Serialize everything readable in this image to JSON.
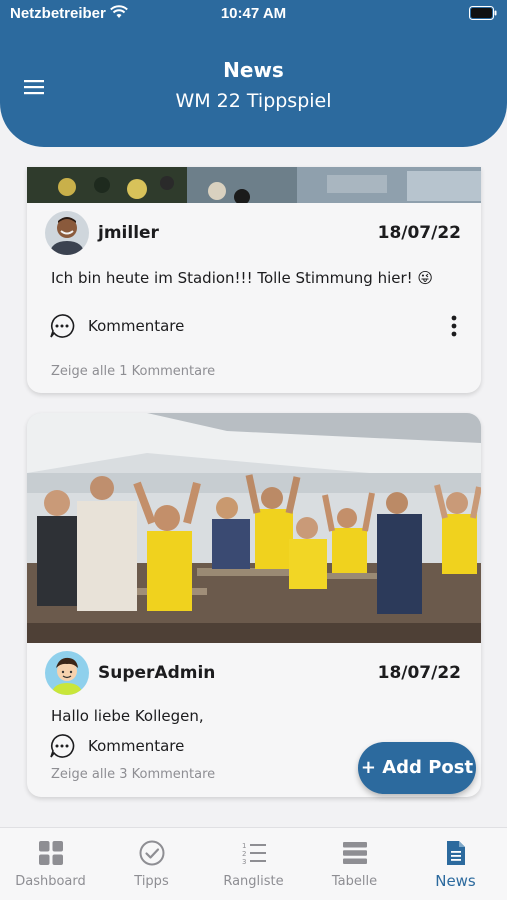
{
  "status_bar": {
    "carrier": "Netzbetreiber",
    "time": "10:47 AM"
  },
  "header": {
    "title": "News",
    "subtitle": "WM 22 Tippspiel"
  },
  "posts": [
    {
      "username": "jmiller",
      "date": "18/07/22",
      "text": "Ich bin heute im Stadion!!! Tolle Stimmung hier! 😜",
      "comments_label": "Kommentare",
      "show_all": "Zeige alle 1 Kommentare"
    },
    {
      "username": "SuperAdmin",
      "date": "18/07/22",
      "text": "Hallo liebe Kollegen,",
      "comments_label": "Kommentare",
      "show_all": "Zeige alle 3 Kommentare"
    }
  ],
  "fab": {
    "label": "+ Add Post"
  },
  "tabs": [
    {
      "label": "Dashboard",
      "icon": "grid-icon",
      "active": false
    },
    {
      "label": "Tipps",
      "icon": "check-circle-icon",
      "active": false
    },
    {
      "label": "Rangliste",
      "icon": "ranked-list-icon",
      "active": false
    },
    {
      "label": "Tabelle",
      "icon": "table-icon",
      "active": false
    },
    {
      "label": "News",
      "icon": "news-icon",
      "active": true
    }
  ],
  "colors": {
    "primary": "#2c6a9e",
    "inactive": "#8e8e93",
    "background": "#f2f2f4"
  }
}
